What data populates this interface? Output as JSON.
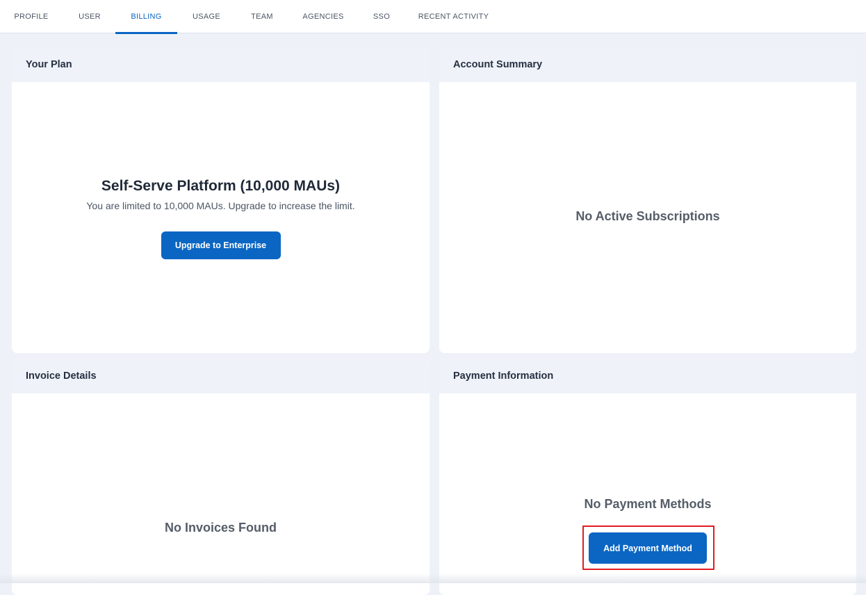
{
  "tabs": [
    {
      "label": "PROFILE"
    },
    {
      "label": "USER"
    },
    {
      "label": "BILLING"
    },
    {
      "label": "USAGE"
    },
    {
      "label": "TEAM"
    },
    {
      "label": "AGENCIES"
    },
    {
      "label": "SSO"
    },
    {
      "label": "RECENT ACTIVITY"
    }
  ],
  "active_tab": "BILLING",
  "your_plan": {
    "header": "Your Plan",
    "title": "Self-Serve Platform (10,000 MAUs)",
    "subtitle": "You are limited to 10,000 MAUs. Upgrade to increase the limit.",
    "button_label": "Upgrade to Enterprise"
  },
  "account_summary": {
    "header": "Account Summary",
    "empty_text": "No Active Subscriptions"
  },
  "invoice_details": {
    "header": "Invoice Details",
    "empty_text": "No Invoices Found"
  },
  "payment_information": {
    "header": "Payment Information",
    "empty_text": "No Payment Methods",
    "button_label": "Add Payment Method"
  },
  "colors": {
    "accent": "#0b66c3",
    "highlight": "#e01b24",
    "background": "#eef2f8",
    "card_header": "#eff2f9"
  }
}
